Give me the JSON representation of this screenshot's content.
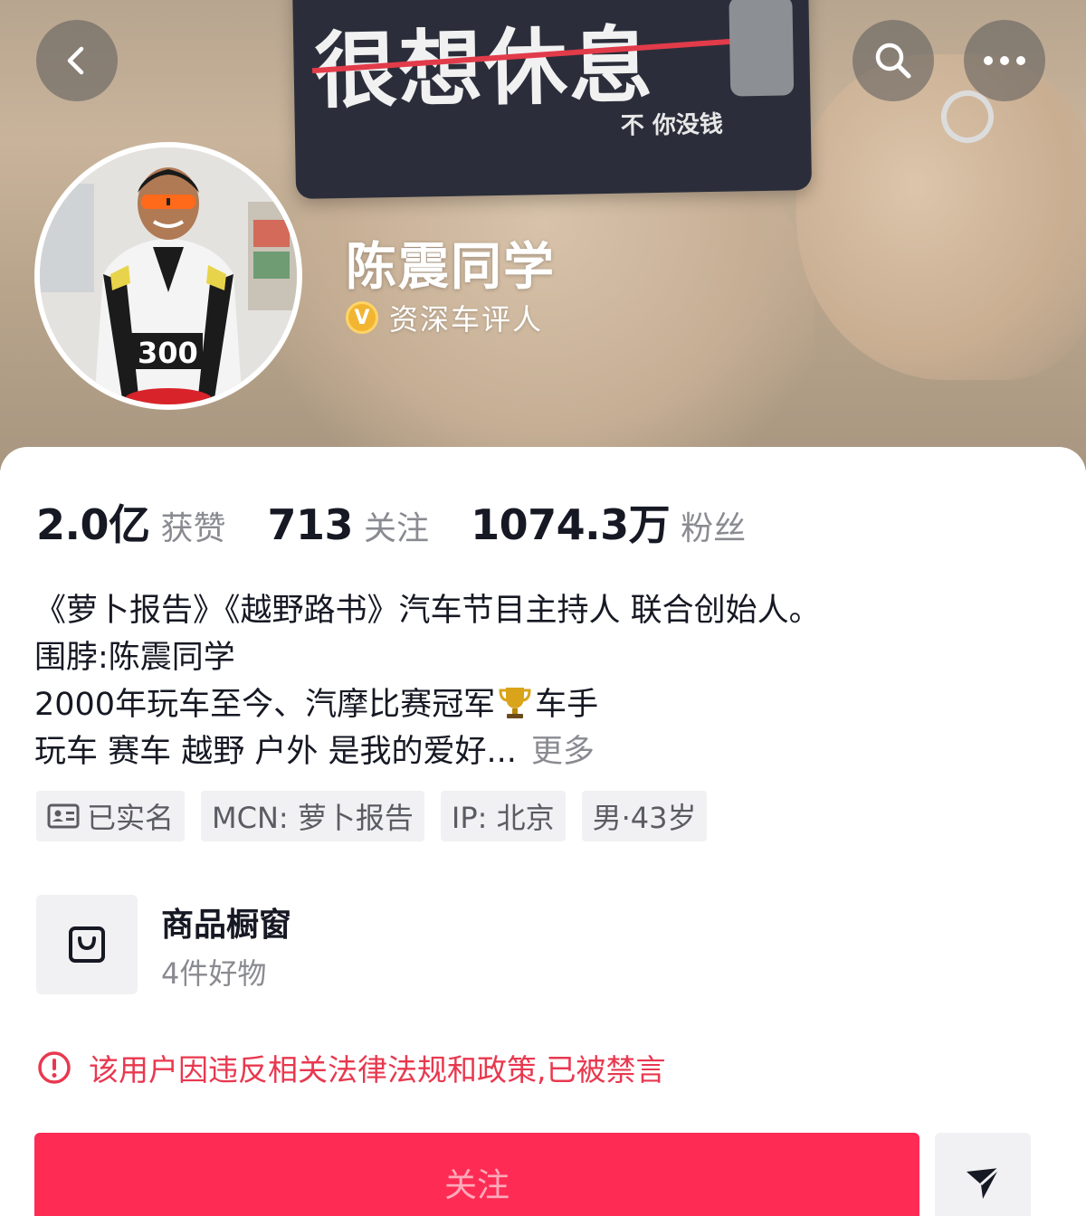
{
  "cover": {
    "sign_text": "很想休息",
    "sign_subtext": "不 你没钱"
  },
  "header": {
    "back_icon": "chevron-left-icon",
    "search_icon": "search-icon",
    "more_icon": "more-dots-icon"
  },
  "profile": {
    "name": "陈震同学",
    "verified_label": "资深车评人",
    "verify_badge": "V"
  },
  "stats": [
    {
      "value": "2.0亿",
      "label": "获赞"
    },
    {
      "value": "713",
      "label": "关注"
    },
    {
      "value": "1074.3万",
      "label": "粉丝"
    }
  ],
  "bio": {
    "line1": "《萝卜报告》《越野路书》汽车节目主持人 联合创始人。",
    "line2": "围脖:陈震同学",
    "line3_before": "2000年玩车至今、汽摩比赛冠军",
    "line3_after": "车手",
    "line4": "玩车 赛车 越野 户外 是我的爱好...",
    "more_label": "更多"
  },
  "tags": [
    {
      "label": "已实名",
      "icon": "id-card-icon"
    },
    {
      "label": "MCN: 萝卜报告"
    },
    {
      "label": "IP: 北京"
    },
    {
      "label": "男·43岁"
    }
  ],
  "shop": {
    "title": "商品橱窗",
    "subtitle": "4件好物",
    "icon": "shopping-bag-icon"
  },
  "notice": {
    "banned_text": "该用户因违反相关法律法规和政策,已被禁言",
    "color": "#e8384f"
  },
  "actions": {
    "follow_label": "关注",
    "follow_color": "#fe2c55",
    "share_icon": "send-icon"
  }
}
